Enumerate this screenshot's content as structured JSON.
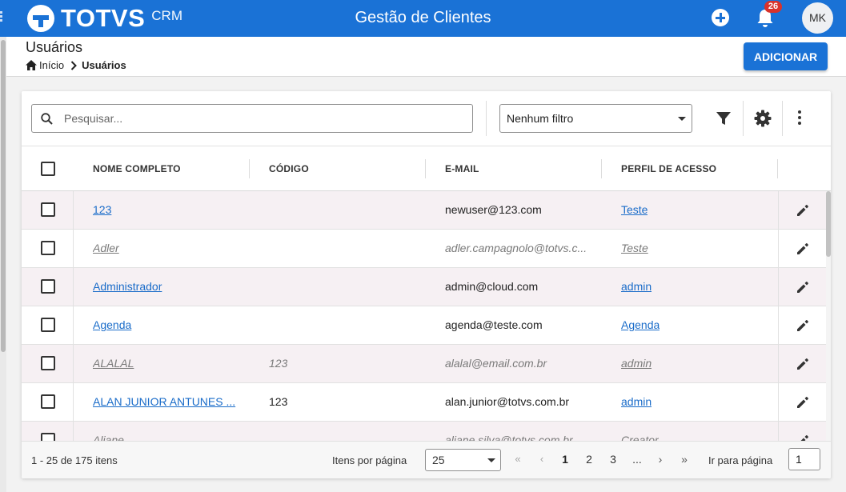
{
  "topbar": {
    "logo_text": "TOTVS",
    "logo_sub": "CRM",
    "title": "Gestão de Clientes",
    "notifications_count": "26",
    "avatar_initials": "MK",
    "background": "#1a72d6"
  },
  "page": {
    "title": "Usuários",
    "breadcrumb": {
      "home": "Início",
      "current": "Usuários"
    },
    "add_button": "ADICIONAR"
  },
  "toolbar": {
    "search_placeholder": "Pesquisar...",
    "filter_value": "Nenhum filtro",
    "icons": [
      "search-icon",
      "funnel-icon",
      "gear-icon",
      "more-vertical-icon"
    ]
  },
  "table": {
    "columns": [
      "NOME COMPLETO",
      "CÓDIGO",
      "E-MAIL",
      "PERFIL DE ACESSO"
    ],
    "rows": [
      {
        "name": "123",
        "code": "",
        "email": "newuser@123.com",
        "profile": "Teste",
        "inactive": false
      },
      {
        "name": "Adler",
        "code": "",
        "email": "adler.campagnolo@totvs.c...",
        "profile": "Teste",
        "inactive": true
      },
      {
        "name": "Administrador",
        "code": "",
        "email": "admin@cloud.com",
        "profile": "admin",
        "inactive": false
      },
      {
        "name": "Agenda",
        "code": "",
        "email": "agenda@teste.com",
        "profile": "Agenda",
        "inactive": false
      },
      {
        "name": "ALALAL",
        "code": "123",
        "email": "alalal@email.com.br",
        "profile": "admin",
        "inactive": true
      },
      {
        "name": "ALAN JUNIOR ANTUNES ...",
        "code": "123",
        "email": "alan.junior@totvs.com.br",
        "profile": "admin",
        "inactive": false
      },
      {
        "name": "Aliane",
        "code": "",
        "email": "aliane.silva@totvs.com.br",
        "profile": "Creator",
        "inactive": true
      }
    ]
  },
  "footer": {
    "range": "1 - 25 de 175 itens",
    "per_page_label": "Itens por página",
    "per_page_value": "25",
    "pages": [
      "1",
      "2",
      "3",
      "..."
    ],
    "nav": {
      "first": "«",
      "prev": "‹",
      "next": "›",
      "last": "»"
    },
    "goto_label": "Ir para página",
    "goto_value": "1"
  }
}
